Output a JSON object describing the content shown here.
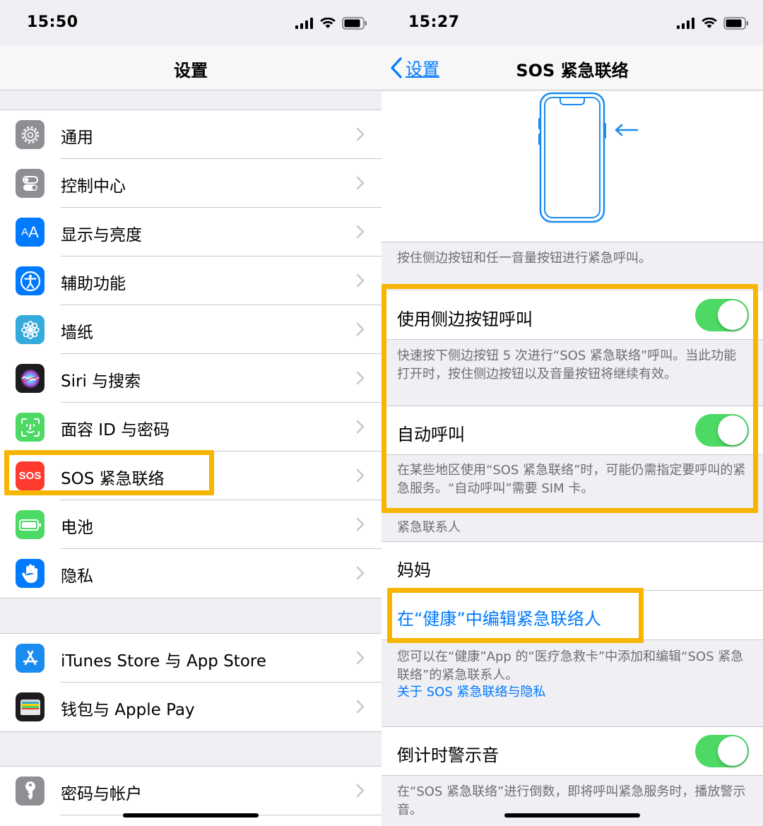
{
  "left": {
    "status_time": "15:50",
    "nav_title": "设置",
    "groups": [
      {
        "items": [
          {
            "label": "通用",
            "icon": "gear-icon",
            "color": "#8e8e93"
          },
          {
            "label": "控制中心",
            "icon": "toggles-icon",
            "color": "#8e8e93"
          },
          {
            "label": "显示与亮度",
            "icon": "text-size-icon",
            "color": "#007aff"
          },
          {
            "label": "辅助功能",
            "icon": "accessibility-icon",
            "color": "#007aff"
          },
          {
            "label": "墙纸",
            "icon": "flower-icon",
            "color": "#35aadc"
          },
          {
            "label": "Siri 与搜索",
            "icon": "siri-icon",
            "color": "#1c1c1e"
          },
          {
            "label": "面容 ID 与密码",
            "icon": "face-id-icon",
            "color": "#4cd964"
          },
          {
            "label": "SOS 紧急联络",
            "icon": "sos-icon",
            "color": "#ff3b30",
            "icon_text": "SOS"
          },
          {
            "label": "电池",
            "icon": "battery-icon",
            "color": "#4cd964"
          },
          {
            "label": "隐私",
            "icon": "hand-icon",
            "color": "#007aff"
          }
        ]
      },
      {
        "items": [
          {
            "label": "iTunes Store 与 App Store",
            "icon": "app-store-icon",
            "color": "#1a8cf0"
          },
          {
            "label": "钱包与 Apple Pay",
            "icon": "wallet-icon",
            "color": "#1c1c1e"
          }
        ]
      },
      {
        "items": [
          {
            "label": "密码与帐户",
            "icon": "key-icon",
            "color": "#8e8e93"
          }
        ]
      }
    ]
  },
  "right": {
    "status_time": "15:27",
    "back_label": "设置",
    "nav_title": "SOS 紧急联络",
    "illustration_caption": "按住侧边按钮和任一音量按钮进行紧急呼叫。",
    "call_with_side": {
      "label": "使用侧边按钮呼叫",
      "on": true,
      "footer": "快速按下侧边按钮 5 次进行“SOS 紧急联络”呼叫。当此功能打开时，按住侧边按钮以及音量按钮将继续有效。"
    },
    "auto_call": {
      "label": "自动呼叫",
      "on": true,
      "footer": "在某些地区使用“SOS 紧急联络”时，可能仍需指定要呼叫的紧急服务。“自动呼叫”需要 SIM 卡。"
    },
    "contacts_header": "紧急联系人",
    "contact_name": "妈妈",
    "edit_contacts_link": "在“健康”中编辑紧急联络人",
    "contacts_footer": "您可以在“健康”App 的“医疗急救卡”中添加和编辑“SOS 紧急联络”的紧急联系人。",
    "privacy_link": "关于 SOS 紧急联络与隐私",
    "countdown": {
      "label": "倒计时警示音",
      "on": true,
      "footer": "在“SOS 紧急联络”进行倒数，即将呼叫紧急服务时，播放警示音。"
    }
  },
  "colors": {
    "highlight": "#f7b500",
    "toggle_on": "#4cd964",
    "link": "#007aff"
  }
}
